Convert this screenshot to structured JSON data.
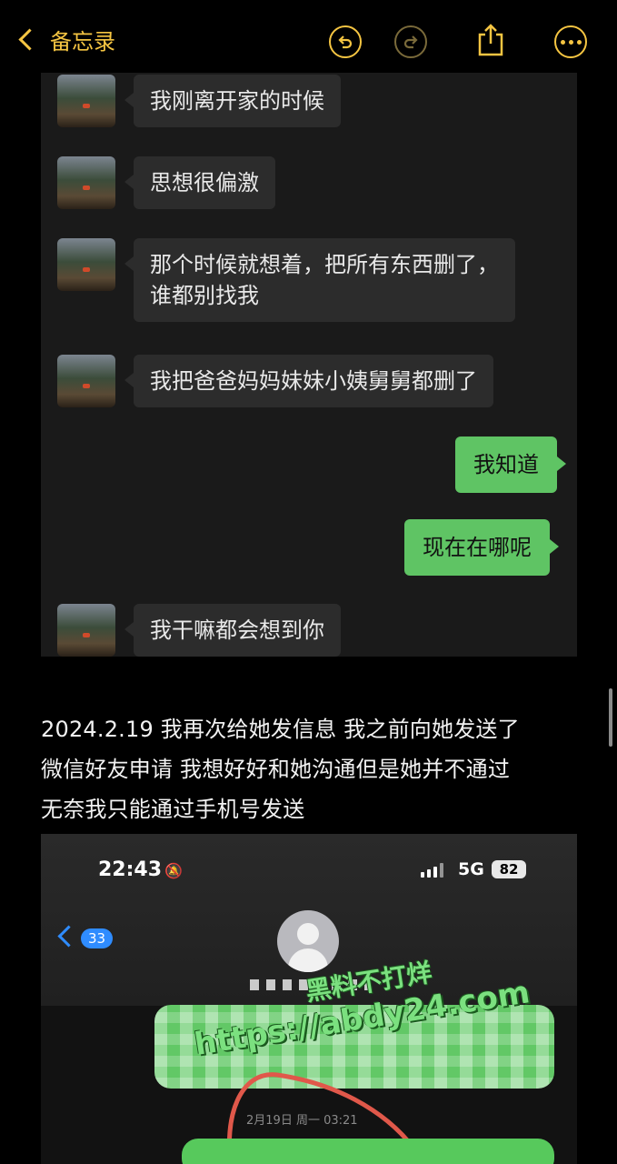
{
  "nav": {
    "back_label": "备忘录",
    "icons": [
      "undo-icon",
      "redo-icon",
      "share-icon",
      "more-icon"
    ]
  },
  "chat": {
    "messages": [
      {
        "side": "left",
        "text": "我刚离开家的时候"
      },
      {
        "side": "left",
        "text": "思想很偏激"
      },
      {
        "side": "left",
        "line1": "那个时候就想着，把所有东西删了，",
        "line2": "谁都别找我"
      },
      {
        "side": "left",
        "text": "我把爸爸妈妈妹妹小姨舅舅都删了"
      },
      {
        "side": "right",
        "text": "我知道"
      },
      {
        "side": "right",
        "text": "现在在哪呢"
      },
      {
        "side": "left",
        "text": "我干嘛都会想到你"
      }
    ]
  },
  "note": {
    "line1": "2024.2.19 我再次给她发信息 我之前向她发送了",
    "line2": "微信好友申请 我想好好和她沟通但是她并不通过",
    "line3": "无奈我只能通过手机号发送"
  },
  "sms": {
    "time": "22:43",
    "network": "5G",
    "battery": "82",
    "unread_count": "33",
    "date_label": "2月19日 周一 03:21"
  },
  "watermark": {
    "line1": "黑料不打烊",
    "line2": "https://abdy24.com"
  },
  "colors": {
    "accent": "#f5c542",
    "wechat_green": "#5fc464",
    "ios_blue": "#2f8cff"
  }
}
